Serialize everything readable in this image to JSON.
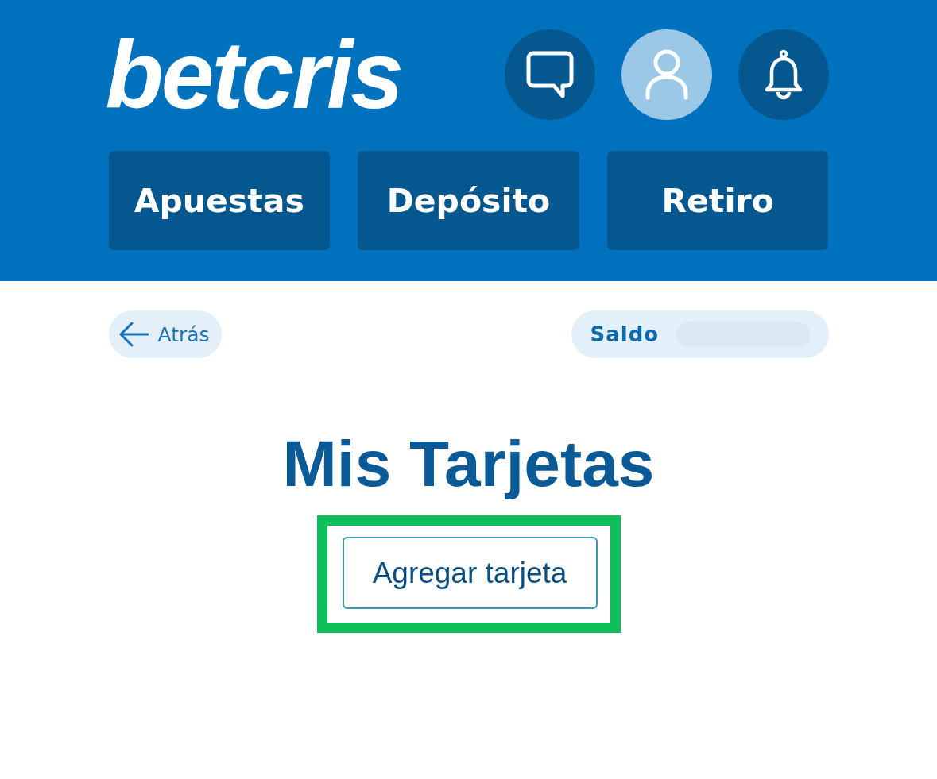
{
  "header": {
    "logo": "betcris",
    "icon_buttons": [
      {
        "kind": "chat",
        "selected": false
      },
      {
        "kind": "account",
        "selected": true
      },
      {
        "kind": "notifications",
        "selected": false
      }
    ],
    "nav": [
      {
        "label": "Apuestas"
      },
      {
        "label": "Depósito"
      },
      {
        "label": "Retiro"
      }
    ]
  },
  "toolbar": {
    "back": {
      "label": "Atrás"
    },
    "balance": {
      "label": "Saldo",
      "masked": true
    }
  },
  "page": {
    "title": "Mis Tarjetas",
    "action": {
      "label": "Agregar tarjeta",
      "highlighted": true
    }
  }
}
